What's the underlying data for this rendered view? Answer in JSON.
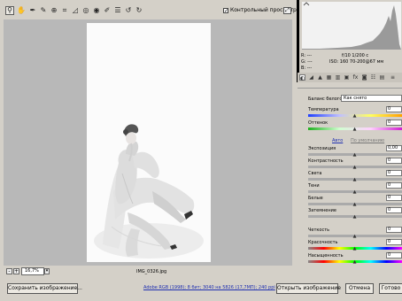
{
  "toolbar": {
    "tools": [
      {
        "icon": "zoom-icon",
        "glyph": "⚲"
      },
      {
        "icon": "hand-icon",
        "glyph": "✋"
      },
      {
        "icon": "white-balance-icon",
        "glyph": "✒"
      },
      {
        "icon": "color-sampler-icon",
        "glyph": "✎"
      },
      {
        "icon": "target-adjust-icon",
        "glyph": "⊕"
      },
      {
        "icon": "crop-icon",
        "glyph": "⌗"
      },
      {
        "icon": "straighten-icon",
        "glyph": "◿"
      },
      {
        "icon": "retouch-icon",
        "glyph": "◎"
      },
      {
        "icon": "red-eye-icon",
        "glyph": "◉"
      },
      {
        "icon": "brush-icon",
        "glyph": "✐"
      },
      {
        "icon": "preferences-icon",
        "glyph": "☰"
      },
      {
        "icon": "rotate-left-icon",
        "glyph": "↺"
      },
      {
        "icon": "rotate-right-icon",
        "glyph": "↻"
      }
    ],
    "preview_label": "Контрольный просмотр",
    "preview_checked": "✓"
  },
  "canvas": {
    "zoom": "16,7%",
    "file_name": "IMG_0326.jpg"
  },
  "info": {
    "r": "R:  ---",
    "g": "G:  ---",
    "b": "B:  ---",
    "aperture_shutter": "f/10   1/200 с",
    "iso_lens": "ISO: 160    70-200@67 мм"
  },
  "panel": {
    "white_balance_label": "Баланс белого:",
    "white_balance_value": "Как снято",
    "temperature_label": "Температура",
    "tint_label": "Оттенок",
    "auto_link": "Авто",
    "default_link": "По умолчанию",
    "sliders": [
      {
        "label": "Экспозиция",
        "value": "0,00"
      },
      {
        "label": "Контрастность",
        "value": "0"
      },
      {
        "label": "Света",
        "value": "0"
      },
      {
        "label": "Тени",
        "value": "0"
      },
      {
        "label": "Белые",
        "value": "0"
      },
      {
        "label": "Затемнение",
        "value": "0"
      },
      {
        "label": "Четкость",
        "value": "0"
      },
      {
        "label": "Красочность",
        "value": "0"
      },
      {
        "label": "Насыщенность",
        "value": "0"
      }
    ],
    "temperature_value": "0",
    "tint_value": "0"
  },
  "footer": {
    "save_button": "Сохранить изображение...",
    "workflow_link": "Adobe RGB (1998); 8 бит; 3040 на 5826 (17,7МП); 240 ppi",
    "open_button": "Открыть изображение",
    "cancel_button": "Отмена",
    "done_button": "Готово"
  },
  "colors": {
    "accent_link": "#2030b0",
    "window_bg": "#d4d0c8"
  }
}
